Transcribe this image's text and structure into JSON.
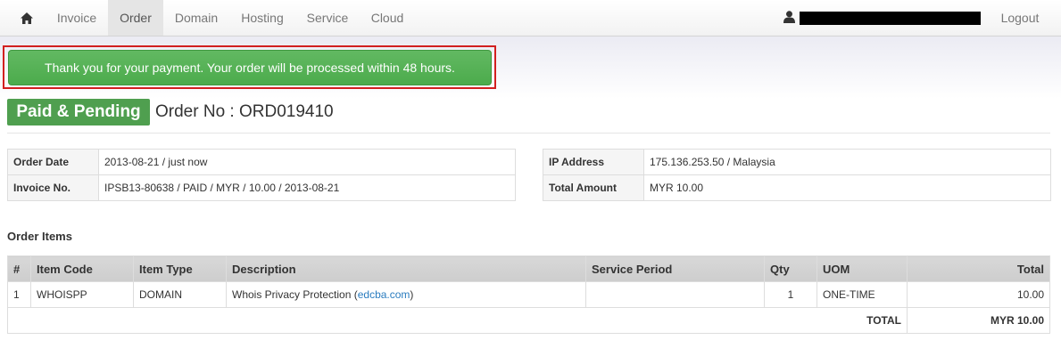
{
  "nav": {
    "home_icon": "home-icon",
    "items": [
      "Invoice",
      "Order",
      "Domain",
      "Hosting",
      "Service",
      "Cloud"
    ],
    "active": "Order",
    "user_icon": "user-icon",
    "logout": "Logout"
  },
  "alert": {
    "message": "Thank you for your payment. Your order will be processed within 48 hours."
  },
  "order": {
    "status": "Paid & Pending",
    "title": "Order No : ORD019410",
    "left_info": [
      {
        "label": "Order Date",
        "value": "2013-08-21 / just now"
      },
      {
        "label": "Invoice No.",
        "value": "IPSB13-80638 / PAID / MYR / 10.00 / 2013-08-21"
      }
    ],
    "right_info": [
      {
        "label": "IP Address",
        "value": "175.136.253.50 / Malaysia"
      },
      {
        "label": "Total Amount",
        "value": "MYR 10.00"
      }
    ]
  },
  "items": {
    "section_title": "Order Items",
    "headers": [
      "#",
      "Item Code",
      "Item Type",
      "Description",
      "Service Period",
      "Qty",
      "UOM",
      "Total"
    ],
    "rows": [
      {
        "num": "1",
        "code": "WHOISPP",
        "type": "DOMAIN",
        "desc_prefix": "Whois Privacy Protection (",
        "desc_link": "edcba.com",
        "desc_suffix": ")",
        "period": "",
        "qty": "1",
        "uom": "ONE-TIME",
        "total": "10.00"
      }
    ],
    "total_label": "TOTAL",
    "total_value": "MYR 10.00"
  },
  "colors": {
    "accent_green": "#4f9f4f",
    "alert_green": "#5cb85c",
    "highlight_red": "#d22020",
    "link_blue": "#2a7cbf"
  }
}
